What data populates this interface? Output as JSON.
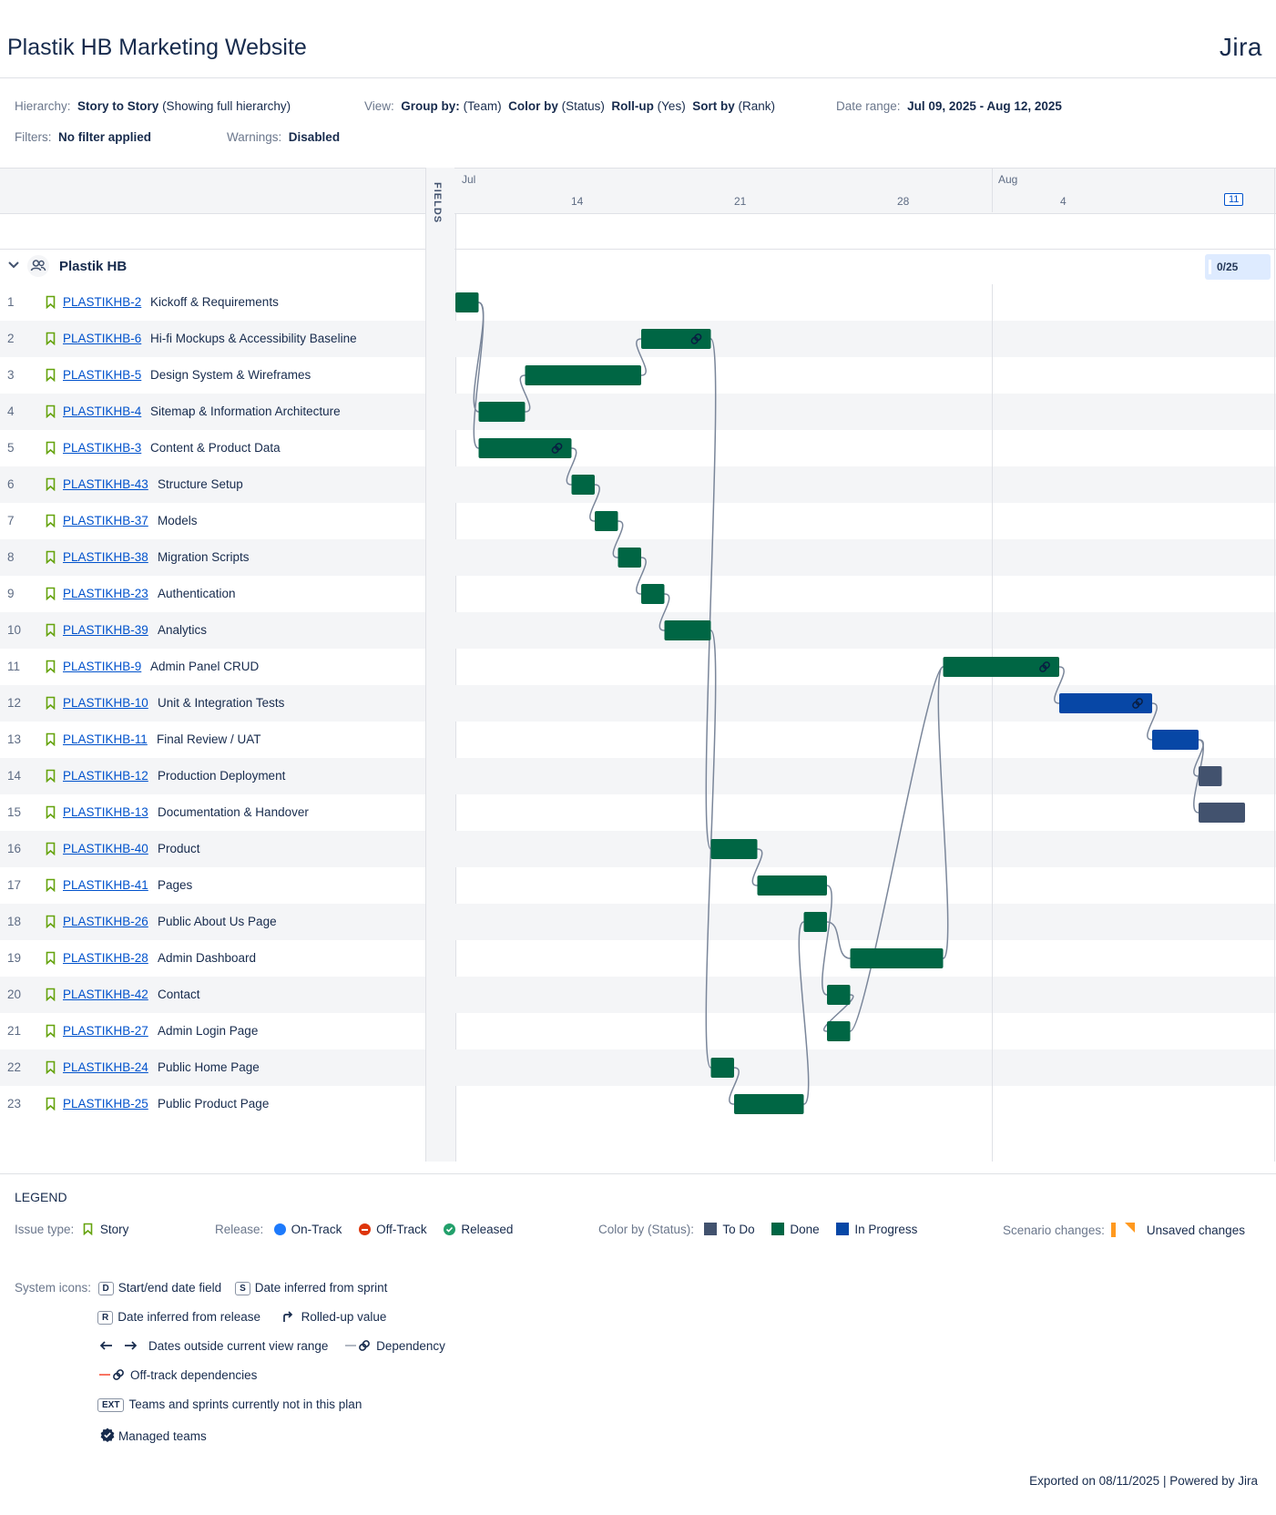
{
  "header": {
    "title": "Plastik HB Marketing Website",
    "brand": "Jira"
  },
  "meta": {
    "hierarchy_label": "Hierarchy:",
    "hierarchy_value_bold": "Story to Story",
    "hierarchy_value_rest": "(Showing full hierarchy)",
    "view_label": "View:",
    "group_by_bold": "Group by:",
    "group_by_val": "(Team)",
    "color_by_bold": "Color by",
    "color_by_val": "(Status)",
    "rollup_bold": "Roll-up",
    "rollup_val": "(Yes)",
    "sort_bold": "Sort by",
    "sort_val": "(Rank)",
    "date_range_label": "Date range:",
    "date_range_value": "Jul 09, 2025 - Aug 12, 2025",
    "filters_label": "Filters:",
    "filters_value": "No filter applied",
    "warnings_label": "Warnings:",
    "warnings_value": "Disabled"
  },
  "fields_label": "FIELDS",
  "timeline": {
    "months": [
      "Jul",
      "Aug"
    ],
    "ticks": [
      "14",
      "21",
      "28",
      "4"
    ],
    "today_label": "11",
    "counter": "0/25"
  },
  "group": {
    "name": "Plastik HB"
  },
  "issues": [
    {
      "n": "1",
      "key": "PLASTIKHB-2",
      "summary": "Kickoff & Requirements",
      "start": "2025-07-09",
      "end": "2025-07-10",
      "status": "Done"
    },
    {
      "n": "2",
      "key": "PLASTIKHB-6",
      "summary": "Hi-fi Mockups & Accessibility Baseline",
      "start": "2025-07-17",
      "end": "2025-07-20",
      "status": "Done",
      "link": true
    },
    {
      "n": "3",
      "key": "PLASTIKHB-5",
      "summary": "Design System & Wireframes",
      "start": "2025-07-12",
      "end": "2025-07-17",
      "status": "Done"
    },
    {
      "n": "4",
      "key": "PLASTIKHB-4",
      "summary": "Sitemap & Information Architecture",
      "start": "2025-07-10",
      "end": "2025-07-12",
      "status": "Done"
    },
    {
      "n": "5",
      "key": "PLASTIKHB-3",
      "summary": "Content & Product Data",
      "start": "2025-07-10",
      "end": "2025-07-14",
      "status": "Done",
      "link": true
    },
    {
      "n": "6",
      "key": "PLASTIKHB-43",
      "summary": "Structure Setup",
      "start": "2025-07-14",
      "end": "2025-07-15",
      "status": "Done"
    },
    {
      "n": "7",
      "key": "PLASTIKHB-37",
      "summary": "Models",
      "start": "2025-07-15",
      "end": "2025-07-16",
      "status": "Done"
    },
    {
      "n": "8",
      "key": "PLASTIKHB-38",
      "summary": "Migration Scripts",
      "start": "2025-07-16",
      "end": "2025-07-17",
      "status": "Done"
    },
    {
      "n": "9",
      "key": "PLASTIKHB-23",
      "summary": "Authentication",
      "start": "2025-07-17",
      "end": "2025-07-18",
      "status": "Done"
    },
    {
      "n": "10",
      "key": "PLASTIKHB-39",
      "summary": "Analytics",
      "start": "2025-07-18",
      "end": "2025-07-20",
      "status": "Done"
    },
    {
      "n": "11",
      "key": "PLASTIKHB-9",
      "summary": "Admin Panel CRUD",
      "start": "2025-07-30",
      "end": "2025-08-04",
      "status": "Done",
      "link": true
    },
    {
      "n": "12",
      "key": "PLASTIKHB-10",
      "summary": "Unit & Integration Tests",
      "start": "2025-08-04",
      "end": "2025-08-08",
      "status": "In Progress",
      "link": true
    },
    {
      "n": "13",
      "key": "PLASTIKHB-11",
      "summary": "Final Review / UAT",
      "start": "2025-08-08",
      "end": "2025-08-10",
      "status": "In Progress"
    },
    {
      "n": "14",
      "key": "PLASTIKHB-12",
      "summary": "Production Deployment",
      "start": "2025-08-10",
      "end": "2025-08-11",
      "status": "To Do"
    },
    {
      "n": "15",
      "key": "PLASTIKHB-13",
      "summary": "Documentation & Handover",
      "start": "2025-08-10",
      "end": "2025-08-12",
      "status": "To Do"
    },
    {
      "n": "16",
      "key": "PLASTIKHB-40",
      "summary": "Product",
      "start": "2025-07-20",
      "end": "2025-07-22",
      "status": "Done"
    },
    {
      "n": "17",
      "key": "PLASTIKHB-41",
      "summary": "Pages",
      "start": "2025-07-22",
      "end": "2025-07-25",
      "status": "Done"
    },
    {
      "n": "18",
      "key": "PLASTIKHB-26",
      "summary": "Public About Us Page",
      "start": "2025-07-24",
      "end": "2025-07-25",
      "status": "Done"
    },
    {
      "n": "19",
      "key": "PLASTIKHB-28",
      "summary": "Admin Dashboard",
      "start": "2025-07-26",
      "end": "2025-07-30",
      "status": "Done"
    },
    {
      "n": "20",
      "key": "PLASTIKHB-42",
      "summary": "Contact",
      "start": "2025-07-25",
      "end": "2025-07-26",
      "status": "Done"
    },
    {
      "n": "21",
      "key": "PLASTIKHB-27",
      "summary": "Admin Login Page",
      "start": "2025-07-25",
      "end": "2025-07-26",
      "status": "Done"
    },
    {
      "n": "22",
      "key": "PLASTIKHB-24",
      "summary": "Public Home Page",
      "start": "2025-07-20",
      "end": "2025-07-21",
      "status": "Done"
    },
    {
      "n": "23",
      "key": "PLASTIKHB-25",
      "summary": "Public Product Page",
      "start": "2025-07-21",
      "end": "2025-07-24",
      "status": "Done"
    }
  ],
  "dependencies": [
    [
      1,
      4
    ],
    [
      1,
      5
    ],
    [
      4,
      3
    ],
    [
      3,
      2
    ],
    [
      5,
      6
    ],
    [
      6,
      7
    ],
    [
      7,
      8
    ],
    [
      8,
      9
    ],
    [
      9,
      10
    ],
    [
      2,
      16
    ],
    [
      10,
      22
    ],
    [
      16,
      17
    ],
    [
      17,
      20
    ],
    [
      20,
      21
    ],
    [
      22,
      23
    ],
    [
      23,
      18
    ],
    [
      18,
      19
    ],
    [
      19,
      11
    ],
    [
      21,
      11
    ],
    [
      11,
      12
    ],
    [
      12,
      13
    ],
    [
      13,
      14
    ],
    [
      13,
      15
    ]
  ],
  "status_colors": {
    "Done": "#006644",
    "In Progress": "#0747a6",
    "To Do": "#42526e"
  },
  "legend": {
    "title": "LEGEND",
    "issue_type_label": "Issue type:",
    "story": "Story",
    "release_label": "Release:",
    "on_track": "On-Track",
    "off_track": "Off-Track",
    "released": "Released",
    "color_by_label": "Color by (Status):",
    "todo": "To Do",
    "done": "Done",
    "in_progress": "In Progress",
    "scenario_label": "Scenario changes:",
    "unsaved": "Unsaved changes",
    "system_icons_label": "System icons:",
    "d_key": "D",
    "start_end": "Start/end date field",
    "s_key": "S",
    "inferred_sprint": "Date inferred from sprint",
    "r_key": "R",
    "inferred_release": "Date inferred from release",
    "rolled_up": "Rolled-up value",
    "outside_range": "Dates outside current view range",
    "dependency": "Dependency",
    "offtrack_deps": "Off-track dependencies",
    "ext_key": "EXT",
    "ext_desc": "Teams and sprints currently not in this plan",
    "managed": "Managed teams"
  },
  "footer": "Exported on 08/11/2025 | Powered by Jira"
}
